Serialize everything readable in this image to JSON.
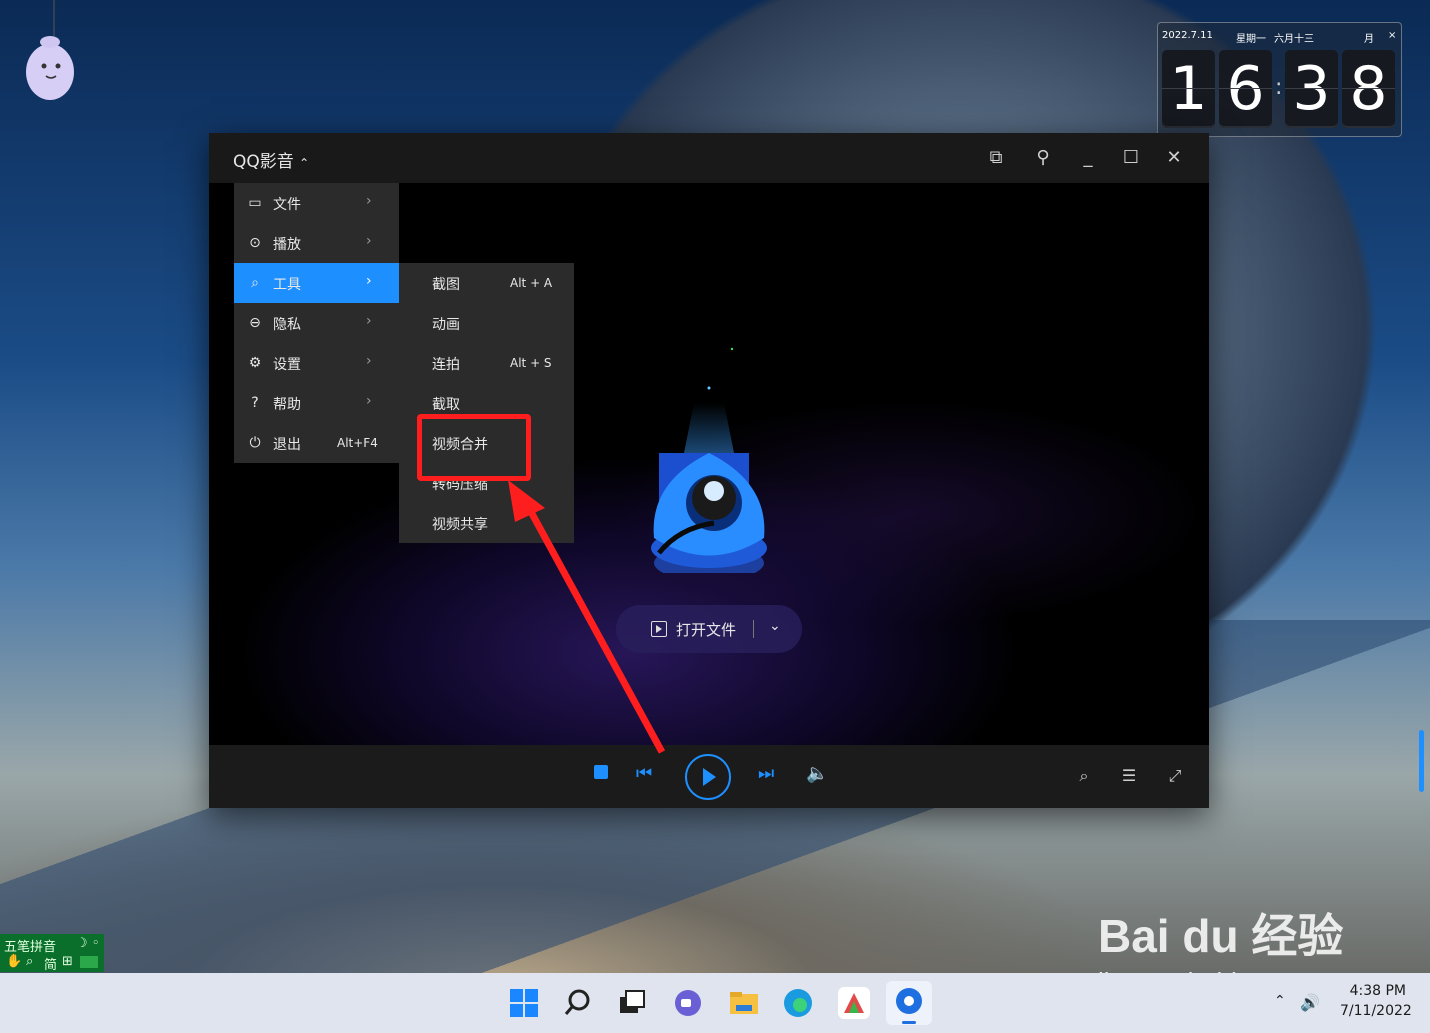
{
  "desktop": {
    "clock_widget": {
      "date": "2022.7.11",
      "weekday": "星期一",
      "lunar": "六月十三",
      "moon_label": "月",
      "close": "×",
      "digits": [
        "1",
        "6",
        "3",
        "8"
      ]
    },
    "ime": {
      "line1": "五笔拼音",
      "mode": "简"
    },
    "watermark": {
      "main": "Bai du 经验",
      "sub": "jingyan.baidu.com"
    }
  },
  "player": {
    "title": "QQ影音",
    "title_caret": "⌃",
    "open_file_label": "打开文件",
    "main_menu": [
      {
        "label": "文件",
        "icon": "folder-icon",
        "glyph": "▭"
      },
      {
        "label": "播放",
        "icon": "play-circle-icon",
        "glyph": "⊙"
      },
      {
        "label": "工具",
        "icon": "tools-icon",
        "glyph": "⌕",
        "active": true
      },
      {
        "label": "隐私",
        "icon": "lock-icon",
        "glyph": "⊖"
      },
      {
        "label": "设置",
        "icon": "gear-icon",
        "glyph": "⚙"
      },
      {
        "label": "帮助",
        "icon": "help-icon",
        "glyph": "?"
      },
      {
        "label": "退出",
        "icon": "power-icon",
        "glyph": "⏻",
        "shortcut": "Alt+F4"
      }
    ],
    "tools_submenu": [
      {
        "label": "截图",
        "shortcut": "Alt + A"
      },
      {
        "label": "动画",
        "shortcut": ""
      },
      {
        "label": "连拍",
        "shortcut": "Alt + S"
      },
      {
        "label": "截取",
        "shortcut": ""
      },
      {
        "label": "视频合并",
        "shortcut": ""
      },
      {
        "label": "转码压缩",
        "shortcut": ""
      },
      {
        "label": "视频共享",
        "shortcut": ""
      }
    ],
    "accent_color": "#1e8fff",
    "highlight_color": "#ff1e1e"
  },
  "taskbar": {
    "time": "4:38 PM",
    "date": "7/11/2022",
    "apps": [
      "start-icon",
      "search-icon",
      "task-view-icon",
      "chat-icon",
      "file-explorer-icon",
      "edge-icon",
      "paint-icon",
      "qq-player-icon"
    ]
  }
}
